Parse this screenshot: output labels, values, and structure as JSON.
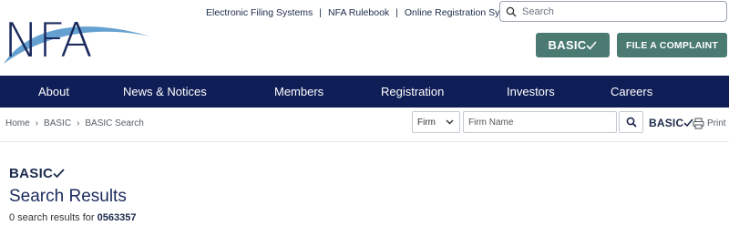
{
  "header": {
    "logo_text": "NFA",
    "top_links": [
      "Electronic Filing Systems",
      "NFA Rulebook",
      "Online Registration System"
    ],
    "top_link_separator": "|",
    "search_placeholder": "Search",
    "basic_button_label": "BASIC",
    "complaint_button_label": "FILE A COMPLAINT"
  },
  "nav": {
    "items": [
      "About",
      "News & Notices",
      "Members",
      "Registration",
      "Investors",
      "Careers"
    ]
  },
  "breadcrumb": {
    "items": [
      "Home",
      "BASIC",
      "BASIC Search"
    ]
  },
  "search_bar": {
    "type_selected": "Firm",
    "input_placeholder": "Firm Name",
    "basic_label": "BASIC",
    "print_label": "Print"
  },
  "results": {
    "logo_label": "BASIC",
    "title": "Search Results",
    "count_prefix": "0 search results for",
    "query": "0563357"
  },
  "colors": {
    "navy": "#0f1e56",
    "teal_button": "#4a7a72",
    "logo_blue": "#1b2a5e",
    "swoosh_blue": "#4a90c8"
  }
}
